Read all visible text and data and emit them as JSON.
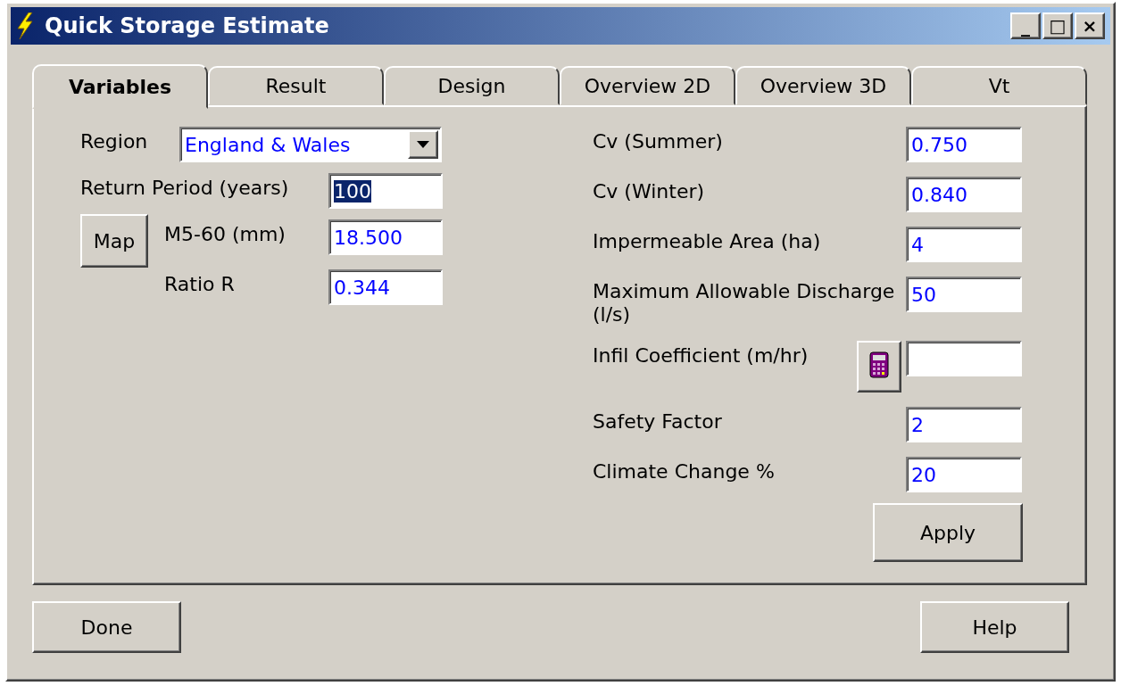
{
  "window": {
    "title": "Quick Storage Estimate",
    "controls": [
      "_",
      "□",
      "×"
    ]
  },
  "tabs": [
    {
      "label": "Variables",
      "selected": true
    },
    {
      "label": "Result",
      "selected": false
    },
    {
      "label": "Design",
      "selected": false
    },
    {
      "label": "Overview 2D",
      "selected": false
    },
    {
      "label": "Overview 3D",
      "selected": false
    },
    {
      "label": "Vt",
      "selected": false
    }
  ],
  "left_fields": [
    {
      "kind": "dropdown",
      "label": "Region",
      "value": "England & Wales"
    },
    {
      "kind": "text",
      "label": "Return Period (years)",
      "value": "100",
      "text_selected": true
    },
    {
      "kind": "text",
      "label": "M5-60 (mm)",
      "value": "18.500",
      "text_selected": false
    },
    {
      "kind": "text",
      "label": "Ratio R",
      "value": "0.344",
      "text_selected": false
    }
  ],
  "map_button": "Map",
  "right_fields": [
    {
      "kind": "text",
      "label": "Cv (Summer)",
      "value": "0.750"
    },
    {
      "kind": "text",
      "label": "Cv (Winter)",
      "value": "0.840"
    },
    {
      "kind": "text",
      "label": "Impermeable Area (ha)",
      "value": "4"
    },
    {
      "kind": "text",
      "label": "Maximum Allowable Discharge (l/s)",
      "value": "50"
    },
    {
      "kind": "calculator",
      "label": "Infil Coefficient (m/hr)"
    },
    {
      "kind": "text",
      "label": "Safety Factor",
      "value": "2"
    },
    {
      "kind": "text",
      "label": "Climate Change %",
      "value": "20"
    }
  ],
  "apply_button": "Apply",
  "footer_buttons": [
    "Done",
    "Help"
  ]
}
